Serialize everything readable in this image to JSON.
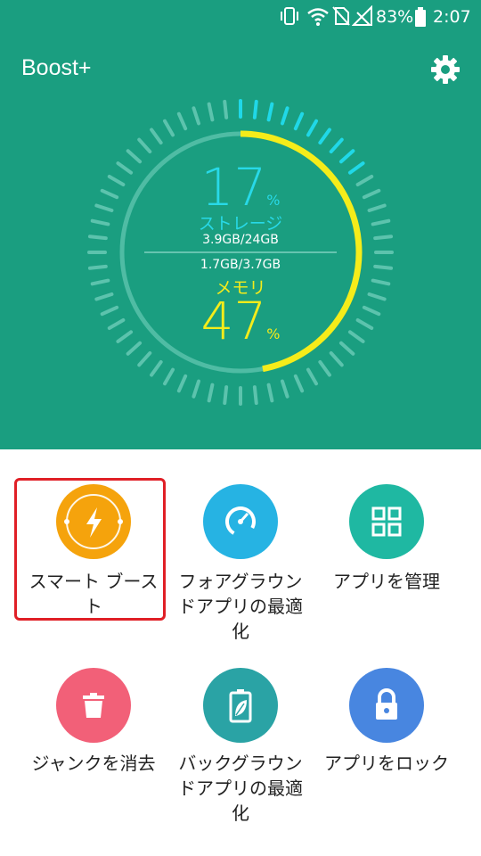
{
  "status_bar": {
    "battery_percent": "83%",
    "time": "2:07"
  },
  "header": {
    "title": "Boost+",
    "settings_icon": "gear-icon"
  },
  "gauge": {
    "storage": {
      "percent": "17",
      "unit": "%",
      "label": "ストレージ",
      "detail": "3.9GB/24GB",
      "level": 0.17
    },
    "memory": {
      "percent": "47",
      "unit": "%",
      "label": "メモリ",
      "detail": "1.7GB/3.7GB",
      "level": 0.47
    },
    "colors": {
      "storage": "#20d8e8",
      "memory": "#f5ec1a",
      "track": "#5cc3ad"
    }
  },
  "actions": [
    {
      "label_line1": "スマート ブース",
      "label_line2": "ト",
      "label_line3": "",
      "icon": "lightning-icon",
      "color": "#f5a30c"
    },
    {
      "label_line1": "フォアグラウン",
      "label_line2": "ドアプリの最適",
      "label_line3": "化",
      "icon": "speedometer-icon",
      "color": "#26b3e3"
    },
    {
      "label_line1": "アプリを管理",
      "label_line2": "",
      "label_line3": "",
      "icon": "grid-icon",
      "color": "#1fb8a2"
    },
    {
      "label_line1": "ジャンクを消去",
      "label_line2": "",
      "label_line3": "",
      "icon": "trash-icon",
      "color": "#f26078"
    },
    {
      "label_line1": "バックグラウン",
      "label_line2": "ドアプリの最適",
      "label_line3": "化",
      "icon": "battery-leaf-icon",
      "color": "#2aa3a5"
    },
    {
      "label_line1": "アプリをロック",
      "label_line2": "",
      "label_line3": "",
      "icon": "lock-icon",
      "color": "#4886e0"
    }
  ]
}
